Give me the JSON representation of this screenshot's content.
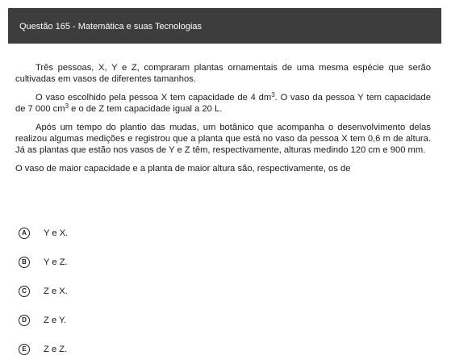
{
  "header": {
    "title": "Questão 165 - Matemática e suas Tecnologias"
  },
  "body": {
    "p1": "Três pessoas, X, Y e Z, compraram plantas ornamentais de uma mesma espécie que serão cultivadas em vasos de diferentes tamanhos.",
    "p2_a": "O vaso escolhido pela pessoa X tem capacidade de 4 dm",
    "p2_sup1": "3",
    "p2_b": ". O vaso da pessoa Y tem capacidade de 7 000 cm",
    "p2_sup2": "3",
    "p2_c": " e o de Z tem capacidade igual a 20 L.",
    "p3": "Após um tempo do plantio das mudas, um botânico que acompanha o desenvolvimento delas realizou algumas medições e registrou que a planta que está no vaso da pessoa X tem 0,6 m de altura. Já as plantas que estão nos vasos de Y e Z têm, respectivamente, alturas medindo 120 cm e 900 mm.",
    "question": "O vaso de maior capacidade e a planta de maior altura são, respectivamente, os de"
  },
  "options": [
    {
      "letter": "A",
      "text": "Y e X."
    },
    {
      "letter": "B",
      "text": "Y e Z."
    },
    {
      "letter": "C",
      "text": "Z e X."
    },
    {
      "letter": "D",
      "text": "Z e Y."
    },
    {
      "letter": "E",
      "text": "Z e Z."
    }
  ]
}
